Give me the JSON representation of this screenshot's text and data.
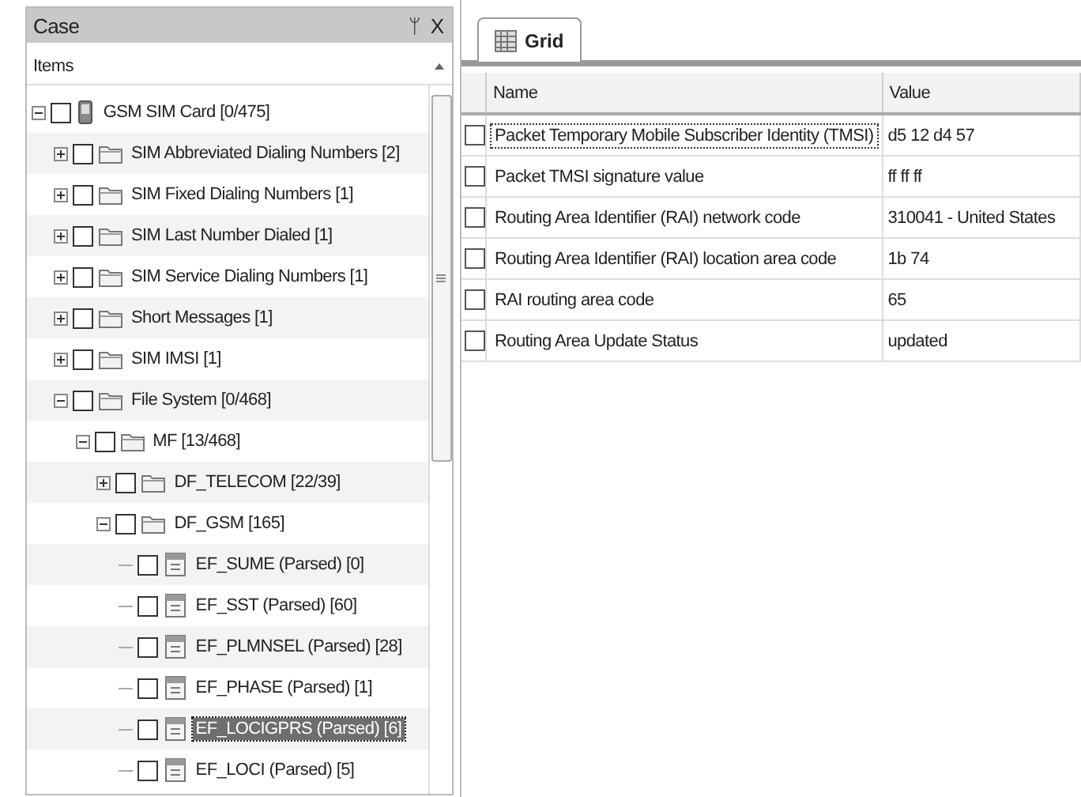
{
  "case_panel": {
    "title": "Case",
    "pin": "ᛘ",
    "close": "X",
    "column_header": "Items",
    "tree": [
      {
        "label": "GSM SIM Card [0/475]",
        "kind": "device",
        "checked": false,
        "expanded": true,
        "selected": false,
        "children": [
          {
            "label": "SIM Abbreviated Dialing Numbers [2]",
            "kind": "folder",
            "checked": false,
            "expanded": false,
            "selected": false
          },
          {
            "label": "SIM Fixed Dialing Numbers [1]",
            "kind": "folder",
            "checked": false,
            "expanded": false,
            "selected": false
          },
          {
            "label": "SIM Last Number Dialed [1]",
            "kind": "folder",
            "checked": false,
            "expanded": false,
            "selected": false
          },
          {
            "label": "SIM Service Dialing Numbers [1]",
            "kind": "folder",
            "checked": false,
            "expanded": false,
            "selected": false
          },
          {
            "label": "Short Messages [1]",
            "kind": "folder",
            "checked": false,
            "expanded": false,
            "selected": false
          },
          {
            "label": "SIM IMSI [1]",
            "kind": "folder",
            "checked": false,
            "expanded": false,
            "selected": false
          },
          {
            "label": "File System [0/468]",
            "kind": "folder",
            "checked": false,
            "expanded": true,
            "selected": false,
            "children": [
              {
                "label": "MF [13/468]",
                "kind": "folder",
                "checked": false,
                "expanded": true,
                "selected": false,
                "children": [
                  {
                    "label": "DF_TELECOM [22/39]",
                    "kind": "folder",
                    "checked": false,
                    "expanded": false,
                    "selected": false
                  },
                  {
                    "label": "DF_GSM [165]",
                    "kind": "folder",
                    "checked": false,
                    "expanded": true,
                    "selected": false,
                    "children": [
                      {
                        "label": "EF_SUME (Parsed) [0]",
                        "kind": "file",
                        "checked": false,
                        "selected": false
                      },
                      {
                        "label": "EF_SST (Parsed) [60]",
                        "kind": "file",
                        "checked": false,
                        "selected": false
                      },
                      {
                        "label": "EF_PLMNSEL (Parsed) [28]",
                        "kind": "file",
                        "checked": false,
                        "selected": false
                      },
                      {
                        "label": "EF_PHASE (Parsed) [1]",
                        "kind": "file",
                        "checked": false,
                        "selected": false
                      },
                      {
                        "label": "EF_LOCIGPRS (Parsed) [6]",
                        "kind": "file",
                        "checked": false,
                        "selected": true
                      },
                      {
                        "label": "EF_LOCI (Parsed) [5]",
                        "kind": "file",
                        "checked": false,
                        "selected": false
                      }
                    ]
                  }
                ]
              }
            ]
          }
        ]
      }
    ]
  },
  "grid_panel": {
    "tabs": [
      {
        "label": "Grid",
        "selected": true
      }
    ],
    "columns": [
      "Name",
      "Value"
    ],
    "rows": [
      {
        "name": "Packet Temporary Mobile Subscriber Identity (TMSI)",
        "value": "d5 12 d4 57",
        "checked": false,
        "focused": true
      },
      {
        "name": "Packet TMSI signature value",
        "value": "ff ff ff",
        "checked": false,
        "focused": false
      },
      {
        "name": "Routing Area Identifier (RAI) network code",
        "value": "310041 - United States",
        "checked": false,
        "focused": false
      },
      {
        "name": "Routing Area Identifier (RAI) location area code",
        "value": "1b 74",
        "checked": false,
        "focused": false
      },
      {
        "name": "RAI routing area code",
        "value": "65",
        "checked": false,
        "focused": false
      },
      {
        "name": "Routing Area Update Status",
        "value": "updated",
        "checked": false,
        "focused": false
      }
    ]
  }
}
